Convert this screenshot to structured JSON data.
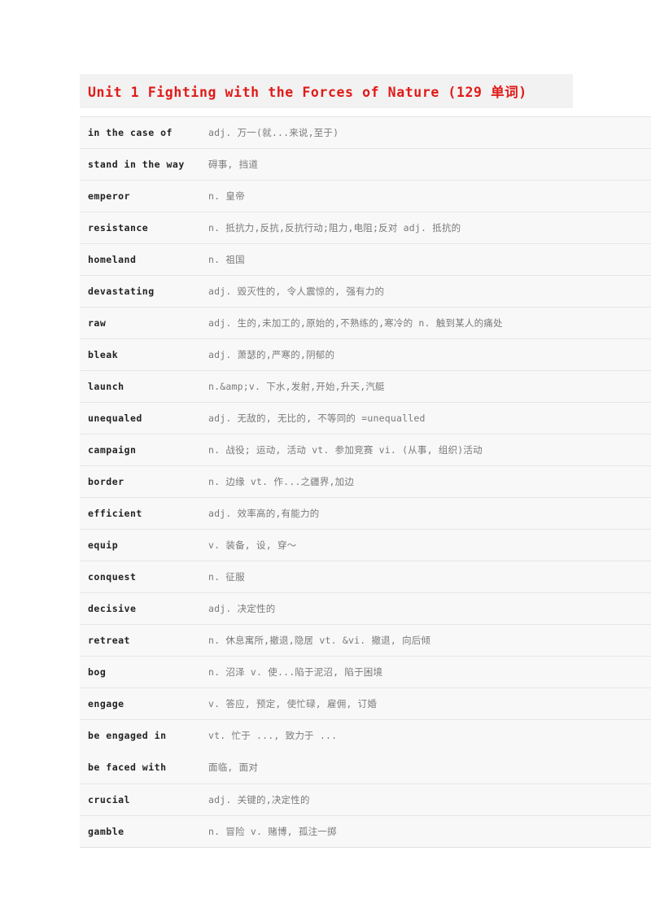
{
  "title": {
    "text": "Unit 1 Fighting with the Forces of Nature (129 单词)",
    "color": "#e01b18",
    "background": "#f2f2f2"
  },
  "table": {
    "background": "#f8f8f8",
    "border_color": "#e6e6e6",
    "word_color": "#222222",
    "definition_color": "#7a7a7a",
    "rows": [
      {
        "word": "in the case of",
        "definition": "adj. 万一(就...来说,至于)"
      },
      {
        "word": "stand in the way",
        "definition": "碍事, 挡道"
      },
      {
        "word": "emperor",
        "definition": "n. 皇帝"
      },
      {
        "word": "resistance",
        "definition": "n. 抵抗力,反抗,反抗行动;阻力,电阻;反对 adj. 抵抗的"
      },
      {
        "word": "homeland",
        "definition": "n. 祖国"
      },
      {
        "word": "devastating",
        "definition": "adj. 毁灭性的, 令人震惊的, 强有力的"
      },
      {
        "word": "raw",
        "definition": "adj. 生的,未加工的,原始的,不熟练的,寒冷的 n. 触到某人的痛处"
      },
      {
        "word": "bleak",
        "definition": "adj. 萧瑟的,严寒的,阴郁的"
      },
      {
        "word": "launch",
        "definition": "n.&amp;v. 下水,发射,开始,升天,汽艇"
      },
      {
        "word": "unequaled",
        "definition": "adj. 无敌的, 无比的, 不等同的 =unequalled"
      },
      {
        "word": "campaign",
        "definition": "n. 战役; 运动, 活动 vt. 参加竞赛 vi. (从事, 组织)活动"
      },
      {
        "word": "border",
        "definition": "n. 边缘 vt. 作...之疆界,加边"
      },
      {
        "word": "efficient",
        "definition": "adj. 效率高的,有能力的"
      },
      {
        "word": "equip",
        "definition": "v. 装备, 设, 穿～"
      },
      {
        "word": "conquest",
        "definition": "n. 征服"
      },
      {
        "word": "decisive",
        "definition": "adj. 决定性的"
      },
      {
        "word": "retreat",
        "definition": "n. 休息寓所,撤退,隐居 vt. &vi. 撤退, 向后倾"
      },
      {
        "word": "bog",
        "definition": "n. 沼泽 v. 使...陷于泥沼, 陷于困境"
      },
      {
        "word": "engage",
        "definition": "v. 答应, 预定, 使忙碌, 雇佣, 订婚"
      },
      {
        "double": true,
        "word_line1": "be engaged in",
        "def_line1": "vt. 忙于 ..., 致力于 ...",
        "word_line2": "be faced with",
        "def_line2": "面临, 面对"
      },
      {
        "word": "crucial",
        "definition": "adj. 关键的,决定性的"
      },
      {
        "word": "gamble",
        "definition": "n. 冒险 v. 赌博, 孤注一掷"
      }
    ]
  }
}
